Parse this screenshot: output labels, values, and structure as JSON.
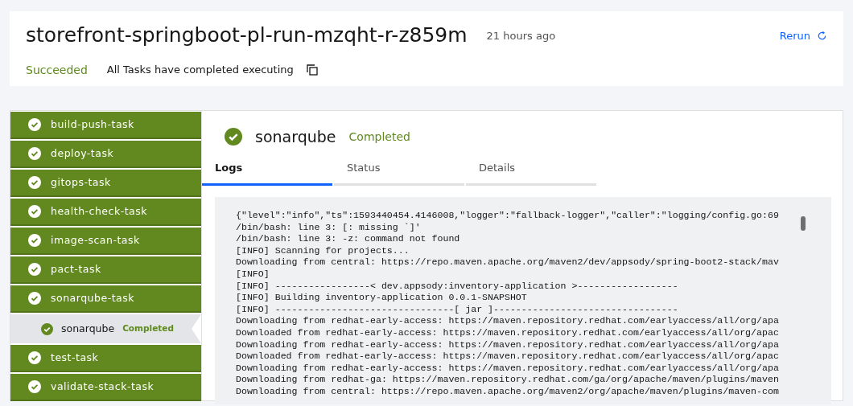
{
  "header": {
    "title": "storefront-springboot-pl-run-mzqht-r-z859m",
    "time": "21 hours ago",
    "rerun": "Rerun",
    "status": "Succeeded",
    "message": "All Tasks have completed executing"
  },
  "tasks": [
    {
      "label": "build-push-task",
      "succeeded": true,
      "selected": false
    },
    {
      "label": "deploy-task",
      "succeeded": true,
      "selected": false
    },
    {
      "label": "gitops-task",
      "succeeded": true,
      "selected": false
    },
    {
      "label": "health-check-task",
      "succeeded": true,
      "selected": false
    },
    {
      "label": "image-scan-task",
      "succeeded": true,
      "selected": false
    },
    {
      "label": "pact-task",
      "succeeded": true,
      "selected": false
    },
    {
      "label": "sonarqube-task",
      "succeeded": true,
      "selected": false,
      "children": [
        {
          "label": "sonarqube",
          "badge": "Completed",
          "succeeded": true,
          "selected": true
        }
      ]
    },
    {
      "label": "test-task",
      "succeeded": true,
      "selected": false
    },
    {
      "label": "validate-stack-task",
      "succeeded": true,
      "selected": false
    }
  ],
  "detail": {
    "title": "sonarqube",
    "succeeded": true,
    "status_text": "Completed",
    "tabs": [
      {
        "label": "Logs",
        "selected": true
      },
      {
        "label": "Status",
        "selected": false
      },
      {
        "label": "Details",
        "selected": false
      }
    ],
    "log_lines": [
      "{\"level\":\"info\",\"ts\":1593440454.4146008,\"logger\":\"fallback-logger\",\"caller\":\"logging/config.go:69",
      "/bin/bash: line 3: [: missing `]'",
      "/bin/bash: line 3: -z: command not found",
      "[INFO] Scanning for projects...",
      "Downloading from central: https://repo.maven.apache.org/maven2/dev/appsody/spring-boot2-stack/mav",
      "[INFO]",
      "[INFO] -----------------< dev.appsody:inventory-application >------------------",
      "[INFO] Building inventory-application 0.0.1-SNAPSHOT",
      "[INFO] --------------------------------[ jar ]---------------------------------",
      "Downloading from redhat-early-access: https://maven.repository.redhat.com/earlyaccess/all/org/apa",
      "Downloaded from redhat-early-access: https://maven.repository.redhat.com/earlyaccess/all/org/apac",
      "Downloading from redhat-early-access: https://maven.repository.redhat.com/earlyaccess/all/org/apa",
      "Downloaded from redhat-early-access: https://maven.repository.redhat.com/earlyaccess/all/org/apac",
      "Downloading from redhat-early-access: https://maven.repository.redhat.com/earlyaccess/all/org/apa",
      "Downloading from redhat-ga: https://maven.repository.redhat.com/ga/org/apache/maven/plugins/maven",
      "Downloading from central: https://repo.maven.apache.org/maven2/org/apache/maven/plugins/maven-com"
    ]
  }
}
